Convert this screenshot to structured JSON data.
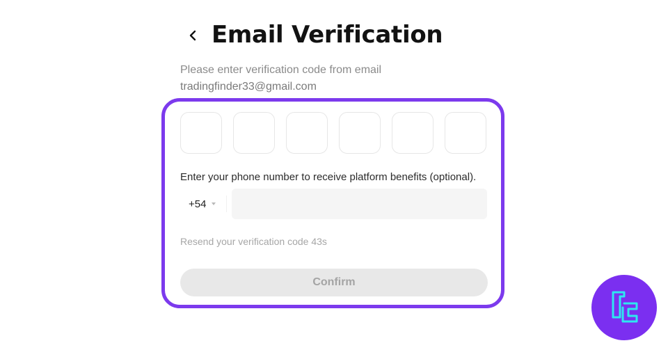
{
  "header": {
    "title": "Email Verification",
    "back_icon": "chevron-left-icon"
  },
  "subtitle": {
    "line1": "Please enter verification code from email",
    "email": "tradingfinder33@gmail.com"
  },
  "code_inputs": {
    "count": 6,
    "values": [
      "",
      "",
      "",
      "",
      "",
      ""
    ]
  },
  "phone": {
    "label": "Enter your phone number to receive platform benefits (optional).",
    "country_code": "+54",
    "value": "",
    "placeholder": ""
  },
  "resend": {
    "text": "Resend your verification code 43s"
  },
  "confirm": {
    "label": "Confirm",
    "disabled": true
  },
  "colors": {
    "highlight": "#7c3aed",
    "watermark_bg": "#7b2ff0",
    "watermark_fg": "#2ee6f0"
  },
  "watermark": {
    "icon": "tradingfinder-logo-icon"
  }
}
